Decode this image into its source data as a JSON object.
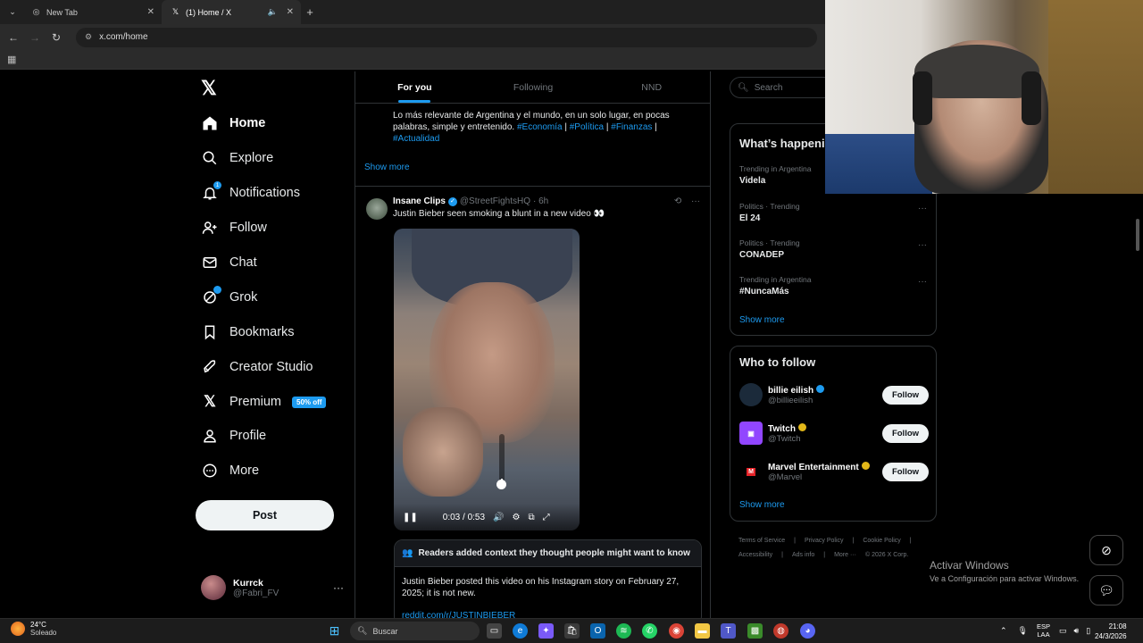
{
  "browser": {
    "tabs": [
      {
        "label": "New Tab"
      },
      {
        "label": "(1) Home / X"
      }
    ],
    "url": "x.com/home"
  },
  "nav": {
    "items": [
      {
        "label": "Home"
      },
      {
        "label": "Explore"
      },
      {
        "label": "Notifications",
        "badge": "1"
      },
      {
        "label": "Follow"
      },
      {
        "label": "Chat"
      },
      {
        "label": "Grok"
      },
      {
        "label": "Bookmarks"
      },
      {
        "label": "Creator Studio"
      },
      {
        "label": "Premium",
        "promo": "50% off"
      },
      {
        "label": "Profile"
      },
      {
        "label": "More"
      }
    ],
    "post_label": "Post",
    "account": {
      "name": "Kurrck",
      "handle": "@Fabri_FV"
    }
  },
  "feed": {
    "tabs": [
      "For you",
      "Following",
      "NND"
    ],
    "bio": {
      "text": "Lo más relevante de Argentina y el mundo, en un solo lugar, en pocas palabras, simple y entretenido.",
      "tags": [
        "#Economía",
        "|",
        "#Política",
        "|",
        "#Finanzas",
        "|",
        "#Actualidad"
      ]
    },
    "show_more": "Show more",
    "post": {
      "name": "Insane Clips",
      "handle": "@StreetFightsHQ",
      "time": "· 6h",
      "text": "Justin Bieber seen smoking a blunt in a new video 👀",
      "video_time": "0:03 / 0:53",
      "video_progress": 0.057,
      "volume_level": 0.15,
      "note_title": "Readers added context they thought people might want to know",
      "note_text": "Justin Bieber posted this video on his Instagram story on February 27, 2025; it is not new.",
      "note_link": "reddit.com/r/JUSTINBIEBER"
    }
  },
  "sidebar": {
    "search_placeholder": "Search",
    "trends_title": "What’s happening",
    "trends": [
      {
        "meta": "Trending in Argentina",
        "name": "Videla"
      },
      {
        "meta": "Politics · Trending",
        "name": "El 24"
      },
      {
        "meta": "Politics · Trending",
        "name": "CONADEP"
      },
      {
        "meta": "Trending in Argentina",
        "name": "#NuncaMás"
      }
    ],
    "show_more": "Show more",
    "wtf_title": "Who to follow",
    "wtf": [
      {
        "name": "billie eilish",
        "handle": "@billieeilish",
        "follow": "Follow"
      },
      {
        "name": "Twitch",
        "handle": "@Twitch",
        "follow": "Follow"
      },
      {
        "name": "Marvel Entertainment",
        "handle": "@Marvel",
        "follow": "Follow"
      }
    ],
    "footer": [
      "Terms of Service",
      "|",
      "Privacy Policy",
      "|",
      "Cookie Policy",
      "|",
      "Accessibility",
      "|",
      "Ads info",
      "|",
      "More ···",
      "© 2026 X Corp."
    ]
  },
  "windows": {
    "activate_title": "Activar Windows",
    "activate_sub": "Ve a Configuración para activar Windows."
  },
  "taskbar": {
    "temp": "24°C",
    "weather": "Soleado",
    "search": "Buscar",
    "lang1": "ESP",
    "lang2": "LAA",
    "time": "21:08",
    "date": "24/3/2026"
  },
  "colors": {
    "accent": "#1d9bf0",
    "background": "#000000",
    "gold_check": "#e2b719"
  }
}
